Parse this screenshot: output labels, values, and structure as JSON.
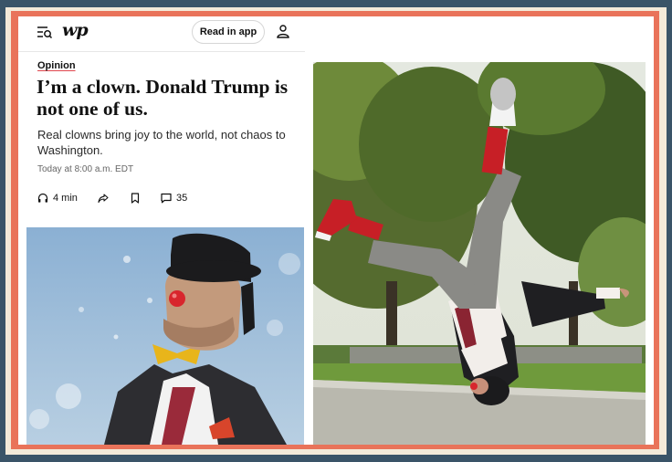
{
  "header": {
    "logo_text": "wp",
    "read_in_app_label": "Read in app",
    "icons": [
      "menu-search-icon",
      "account-icon"
    ]
  },
  "article": {
    "kicker": "Opinion",
    "headline": "I’m a clown. Donald Trump is not one of us.",
    "dek": "Real clowns bring joy to the world, not chaos to Washington.",
    "timestamp": "Today at 8:00 a.m. EDT",
    "listen_time": "4 min",
    "comment_count": "35",
    "action_icons": [
      "headphones-icon",
      "share-icon",
      "bookmark-icon",
      "comment-icon"
    ]
  },
  "colors": {
    "outer_bg": "#3a5468",
    "frame_cream": "#f3ead9",
    "frame_orange": "#e9735a",
    "kicker_underline": "#e0484f"
  }
}
